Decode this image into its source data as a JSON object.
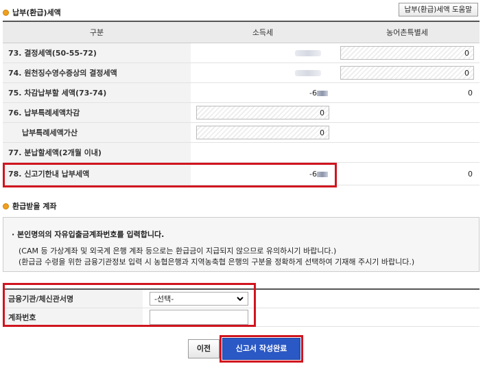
{
  "payment_section": {
    "title": "납부(환급)세액",
    "help_button": "납부(환급)세액 도움말",
    "headers": [
      "구분",
      "소득세",
      "농어촌특별세"
    ],
    "rows": [
      {
        "label": "73. 결정세액(50-55-72)",
        "special": "0"
      },
      {
        "label": "74. 원천징수영수증상의 결정세액",
        "special": "0"
      },
      {
        "label": "75. 차감납부할 세액(73-74)",
        "income": "-6",
        "special": "0"
      },
      {
        "label": "76. 납부특례세액차감",
        "income": "0"
      },
      {
        "label": "납부특례세액가산",
        "income": "0"
      },
      {
        "label": "77. 분납할세액(2개월 이내)"
      },
      {
        "label": "78. 신고기한내 납부세액",
        "income": "-6",
        "special": "0"
      }
    ]
  },
  "refund_section": {
    "title": "환급받을 계좌",
    "notice_title": "· 본인명의의 자유입출금계좌번호를 입력합니다.",
    "notice_line1": "(CAM 등 가상계좌 및 외국계 은행 계좌 등으로는 환급금이 지급되지 않으므로 유의하시기 바랍니다.)",
    "notice_line2": "(환급금 수령을 위한 금융기관정보 입력 시 농협은행과 지역농축협 은행의 구분을 정확하게 선택하여 기재해 주시기 바랍니다.)",
    "bank_label": "금융기관/체신관서명",
    "bank_selected": "-선택-",
    "account_label": "계좌번호",
    "account_value": ""
  },
  "buttons": {
    "prev": "이전",
    "submit": "신고서 작성완료"
  },
  "colors": {
    "highlight": "#d0141e",
    "primary_button": "#2a58c4"
  }
}
